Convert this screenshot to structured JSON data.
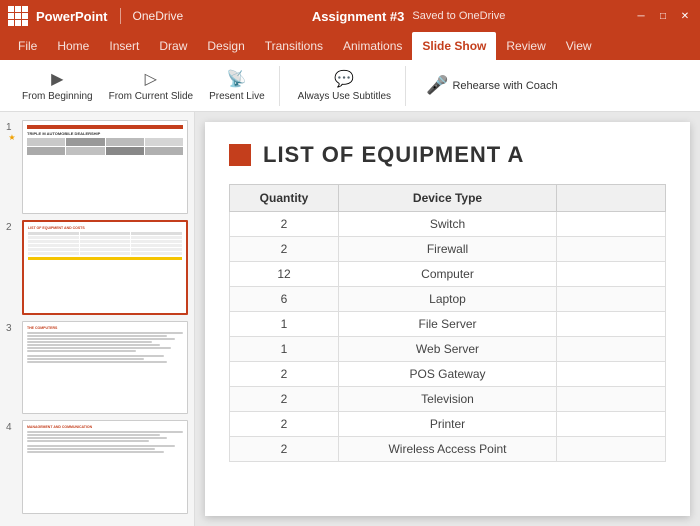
{
  "titleBar": {
    "appName": "PowerPoint",
    "cloudService": "OneDrive",
    "documentTitle": "Assignment #3",
    "savedStatus": "Saved to OneDrive"
  },
  "ribbonTabs": [
    {
      "label": "File"
    },
    {
      "label": "Home"
    },
    {
      "label": "Insert"
    },
    {
      "label": "Draw"
    },
    {
      "label": "Design"
    },
    {
      "label": "Transitions"
    },
    {
      "label": "Animations"
    },
    {
      "label": "Slide Show",
      "active": true
    },
    {
      "label": "Review"
    },
    {
      "label": "View"
    }
  ],
  "ribbonCommands": {
    "fromBeginning": "From Beginning",
    "fromCurrentSlide": "From Current Slide",
    "presentLive": "Present Live",
    "alwaysUseSubtitles": "Always Use Subtitles",
    "rehearseWithCoach": "Rehearse with Coach"
  },
  "slides": [
    {
      "num": 1,
      "starred": true,
      "title": "TRIPLE M AUTOMOBILE DEALERSHIP",
      "type": "title"
    },
    {
      "num": 2,
      "starred": false,
      "title": "LIST OF EQUIPMENT AND COSTS",
      "type": "table",
      "active": true
    },
    {
      "num": 3,
      "starred": false,
      "title": "THE COMPUTERS",
      "type": "text"
    },
    {
      "num": 4,
      "starred": false,
      "title": "MANAGEMENT AND COMMUNICATION",
      "type": "text"
    }
  ],
  "mainSlide": {
    "heading": "LIST OF EQUIPMENT A",
    "tableHeaders": [
      "Quantity",
      "Device Type",
      ""
    ],
    "tableRows": [
      {
        "quantity": "2",
        "device": "Switch"
      },
      {
        "quantity": "2",
        "device": "Firewall"
      },
      {
        "quantity": "12",
        "device": "Computer"
      },
      {
        "quantity": "6",
        "device": "Laptop"
      },
      {
        "quantity": "1",
        "device": "File Server"
      },
      {
        "quantity": "1",
        "device": "Web Server"
      },
      {
        "quantity": "2",
        "device": "POS Gateway"
      },
      {
        "quantity": "2",
        "device": "Television"
      },
      {
        "quantity": "2",
        "device": "Printer"
      },
      {
        "quantity": "2",
        "device": "Wireless Access Point"
      }
    ]
  }
}
